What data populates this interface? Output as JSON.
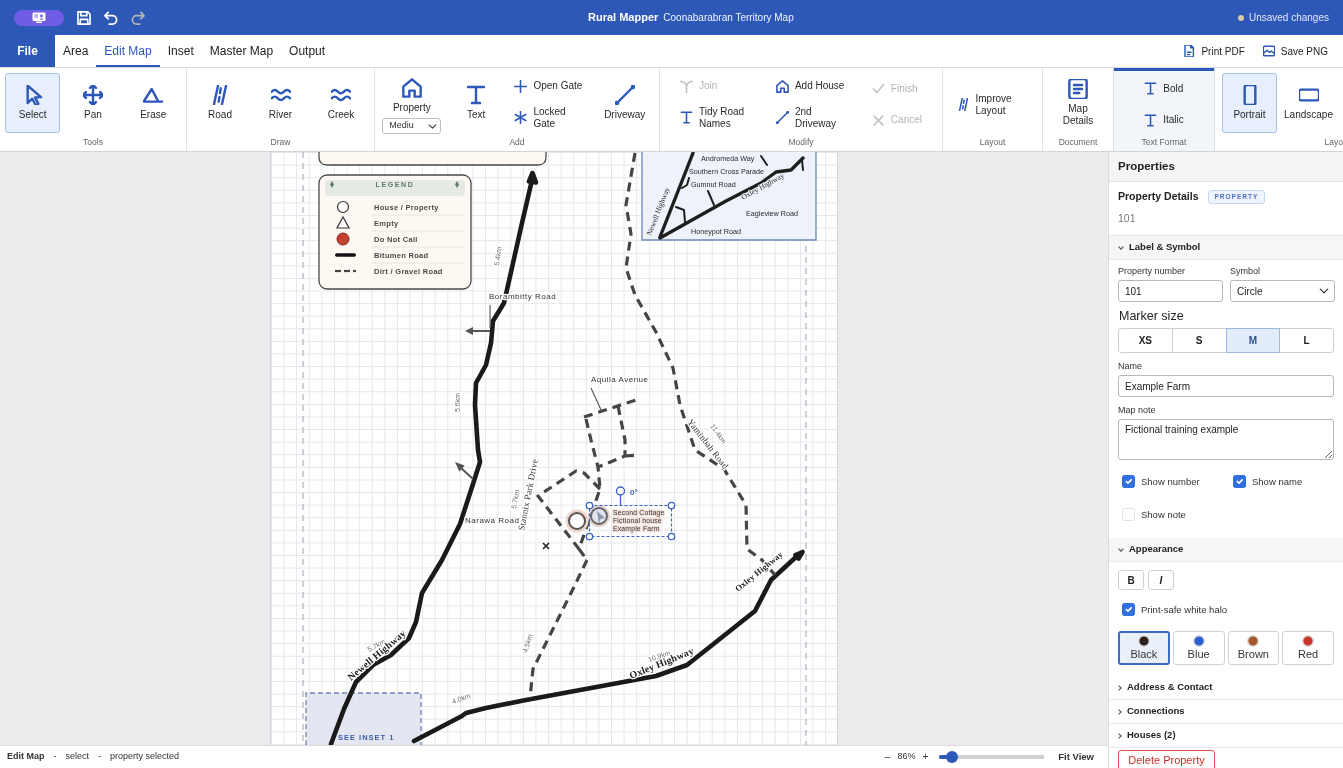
{
  "title_bar": {
    "app_name": "Rural Mapper",
    "document": "Coonabarabran Territory Map",
    "status": "Unsaved changes",
    "quick_actions": [
      {
        "kind": "save",
        "disabled": false
      },
      {
        "kind": "undo",
        "disabled": false
      },
      {
        "kind": "redo",
        "disabled": true
      }
    ]
  },
  "menu": {
    "file": "File",
    "tabs": [
      {
        "label": "Area",
        "selected": false
      },
      {
        "label": "Edit Map",
        "selected": true
      },
      {
        "label": "Inset",
        "selected": false
      },
      {
        "label": "Master Map",
        "selected": false
      },
      {
        "label": "Output",
        "selected": false
      }
    ],
    "actions": [
      {
        "kind": "pdf",
        "label": "Print PDF"
      },
      {
        "kind": "image",
        "label": "Save PNG"
      }
    ]
  },
  "ribbon": [
    {
      "label": "Tools",
      "active": false,
      "columns": [
        {
          "compact": false,
          "buttons": [
            {
              "kind": "pointer",
              "label": "Select",
              "selected": true,
              "disabled": false
            }
          ]
        },
        {
          "compact": false,
          "buttons": [
            {
              "kind": "move",
              "label": "Pan",
              "selected": false,
              "disabled": false
            }
          ]
        },
        {
          "compact": false,
          "buttons": [
            {
              "kind": "eraser",
              "label": "Erase",
              "selected": false,
              "disabled": false
            }
          ]
        }
      ]
    },
    {
      "label": "Draw",
      "active": false,
      "columns": [
        {
          "compact": false,
          "buttons": [
            {
              "kind": "road",
              "label": "Road",
              "selected": false,
              "disabled": false
            }
          ]
        },
        {
          "compact": false,
          "buttons": [
            {
              "kind": "waves",
              "label": "River",
              "selected": false,
              "disabled": false
            }
          ]
        },
        {
          "compact": false,
          "buttons": [
            {
              "kind": "waves",
              "label": "Creek",
              "selected": false,
              "disabled": false
            }
          ]
        }
      ]
    },
    {
      "label": "Add",
      "active": false,
      "columns": [
        {
          "compact": false,
          "buttons": [
            {
              "kind": "house",
              "label": "Property",
              "dropdown": "Mediu",
              "selected": false,
              "disabled": false
            }
          ]
        },
        {
          "compact": false,
          "buttons": [
            {
              "kind": "text",
              "label": "Text",
              "selected": false,
              "disabled": false
            }
          ]
        },
        {
          "compact": true,
          "buttons": [
            {
              "kind": "plus",
              "label": "Open Gate",
              "selected": false,
              "disabled": false
            },
            {
              "kind": "asterisk",
              "label": "Locked Gate",
              "selected": false,
              "disabled": false
            }
          ]
        },
        {
          "compact": false,
          "buttons": [
            {
              "kind": "line",
              "label": "Driveway",
              "selected": false,
              "disabled": false
            }
          ]
        }
      ]
    },
    {
      "label": "Modify",
      "active": false,
      "columns": [
        {
          "compact": true,
          "buttons": [
            {
              "kind": "join",
              "label": "Join",
              "selected": false,
              "disabled": true
            },
            {
              "kind": "text",
              "label": "Tidy Road Names",
              "selected": false,
              "disabled": false
            }
          ]
        },
        {
          "compact": true,
          "buttons": [
            {
              "kind": "house",
              "label": "Add House",
              "selected": false,
              "disabled": false
            },
            {
              "kind": "line",
              "label": "2nd Driveway",
              "selected": false,
              "disabled": false
            }
          ]
        },
        {
          "compact": true,
          "buttons": [
            {
              "kind": "check",
              "label": "Finish",
              "selected": false,
              "disabled": true
            },
            {
              "kind": "cross",
              "label": "Cancel",
              "selected": false,
              "disabled": true
            }
          ]
        }
      ]
    },
    {
      "label": "Layout",
      "active": false,
      "columns": [
        {
          "compact": true,
          "buttons": [
            {
              "kind": "road",
              "label": "Improve Layout",
              "selected": false,
              "disabled": false
            }
          ]
        }
      ]
    },
    {
      "label": "Document",
      "active": false,
      "columns": [
        {
          "compact": false,
          "buttons": [
            {
              "kind": "document",
              "label": "Map Details",
              "selected": false,
              "disabled": false
            }
          ]
        }
      ]
    },
    {
      "label": "Text Format",
      "active": true,
      "columns": [
        {
          "compact": true,
          "buttons": [
            {
              "kind": "text",
              "label": "Bold",
              "selected": false,
              "disabled": false
            },
            {
              "kind": "text",
              "label": "Italic",
              "selected": false,
              "disabled": false
            }
          ]
        }
      ]
    },
    {
      "label": "Layo",
      "active": false,
      "columns": [
        {
          "compact": false,
          "buttons": [
            {
              "kind": "portrait",
              "label": "Portrait",
              "selected": true,
              "disabled": false
            }
          ]
        },
        {
          "compact": false,
          "buttons": [
            {
              "kind": "landscape",
              "label": "Landscape",
              "selected": false,
              "disabled": false
            }
          ]
        }
      ]
    }
  ],
  "map": {
    "legend": {
      "title": "LEGEND",
      "entries": [
        {
          "kind": "open-circle",
          "label": "House / Property"
        },
        {
          "kind": "triangle",
          "label": "Empty"
        },
        {
          "kind": "filled-circle",
          "label": "Do Not Call"
        },
        {
          "kind": "solid-line",
          "label": "Bitumen Road"
        },
        {
          "kind": "dashed-line",
          "label": "Dirt / Gravel Road"
        }
      ]
    },
    "inset": {
      "labels": [
        "Andromeda Way",
        "Southern Cross Parade",
        "Gumnut Road",
        "Oxley Highway",
        "Eagleview Road",
        "Newell Highway",
        "Honeypot Road"
      ]
    },
    "labels": [
      {
        "kind": "distance",
        "text": "5.4km"
      },
      {
        "kind": "road",
        "text": "Borambitty Road"
      },
      {
        "kind": "road",
        "text": "Aquila Avenue"
      },
      {
        "kind": "distance",
        "text": "5.6km"
      },
      {
        "kind": "serif",
        "text": "Yaminbah Road"
      },
      {
        "kind": "distance",
        "text": "11.4km"
      },
      {
        "kind": "serif",
        "text": "Stannix Park Drive"
      },
      {
        "kind": "distance",
        "text": "5.7km"
      },
      {
        "kind": "road",
        "text": "Narawa Road"
      },
      {
        "kind": "highway",
        "text": "Oxley Highway"
      },
      {
        "kind": "distance",
        "text": "4.5km"
      },
      {
        "kind": "distance",
        "text": "5.7km"
      },
      {
        "kind": "highway",
        "text": "Newell Highway"
      },
      {
        "kind": "distance",
        "text": "10.9km"
      },
      {
        "kind": "highway",
        "text": "Oxley Highway"
      },
      {
        "kind": "distance",
        "text": "4.0km"
      }
    ],
    "selection": {
      "angle": "0°",
      "labels": [
        "Second Cottage",
        "Fictional house",
        "Example Farm"
      ]
    },
    "inset_callout": "SEE INSET 1"
  },
  "properties": {
    "title": "Properties",
    "heading": "Property Details",
    "badge": "PROPERTY",
    "number": "101",
    "label_symbol": {
      "title": "Label & Symbol",
      "expanded": true,
      "number_label": "Property number",
      "number_value": "101",
      "symbol_label": "Symbol",
      "symbol_value": "Circle",
      "size_label": "Marker size",
      "sizes": [
        {
          "label": "XS",
          "selected": false
        },
        {
          "label": "S",
          "selected": false
        },
        {
          "label": "M",
          "selected": true
        },
        {
          "label": "L",
          "selected": false
        }
      ],
      "name_label": "Name",
      "name_value": "Example Farm",
      "note_label": "Map note",
      "note_value": "Fictional training example",
      "toggles": [
        {
          "label": "Show number",
          "checked": true
        },
        {
          "label": "Show name",
          "checked": true
        },
        {
          "label": "Show note",
          "checked": false
        }
      ]
    },
    "appearance": {
      "title": "Appearance",
      "expanded": true,
      "styles": [
        {
          "kind": "bold",
          "label": "B"
        },
        {
          "kind": "italic",
          "label": "I"
        }
      ],
      "halo": {
        "label": "Print-safe white halo",
        "checked": true
      },
      "colors": [
        {
          "label": "Black",
          "color": "#2b2420",
          "selected": true
        },
        {
          "label": "Blue",
          "color": "#2f5fcf",
          "selected": false
        },
        {
          "label": "Brown",
          "color": "#a5562a",
          "selected": false
        },
        {
          "label": "Red",
          "color": "#c8372d",
          "selected": false
        }
      ]
    },
    "more_sections": [
      {
        "title": "Address & Contact",
        "expanded": false
      },
      {
        "title": "Connections",
        "expanded": false
      },
      {
        "title": "Houses (2)",
        "expanded": false
      }
    ],
    "delete": "Delete Property"
  },
  "status_bar": {
    "items": [
      {
        "kind": "mode",
        "text": "Edit Map"
      },
      {
        "kind": "separator",
        "text": "-"
      },
      {
        "kind": "text",
        "text": "select"
      },
      {
        "kind": "separator",
        "text": "-"
      },
      {
        "kind": "text",
        "text": "property selected"
      }
    ],
    "zoom_out": "–",
    "zoom": "86%",
    "zoom_in": "+",
    "zoom_slider": {
      "level": 0.12
    },
    "fit": "Fit View"
  }
}
